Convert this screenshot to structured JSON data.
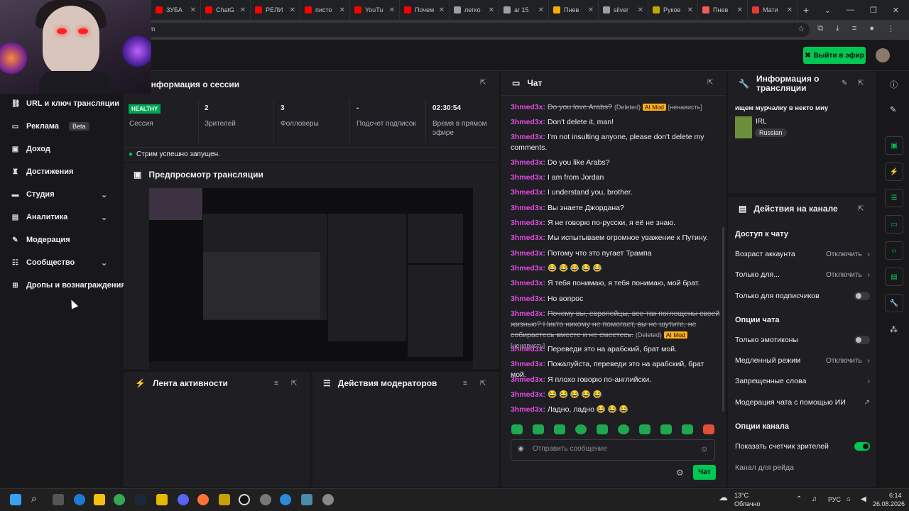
{
  "browser": {
    "tabs": [
      {
        "title": "ЗУБА",
        "color": "#ff0000"
      },
      {
        "title": "ChatG",
        "color": "#ff0000"
      },
      {
        "title": "РЕЛИ",
        "color": "#ff0000"
      },
      {
        "title": "писто",
        "color": "#ff0000"
      },
      {
        "title": "YouTu",
        "color": "#ff0000"
      },
      {
        "title": "Почем",
        "color": "#ff0000"
      },
      {
        "title": "легко",
        "color": "#9aa0a6"
      },
      {
        "title": "ar 15",
        "color": "#9aa0a6"
      },
      {
        "title": "Пнев",
        "color": "#f9ab00"
      },
      {
        "title": "silver",
        "color": "#9aa0a6"
      },
      {
        "title": "Руков",
        "color": "#c6a700"
      },
      {
        "title": "Пнев",
        "color": "#f25c54"
      },
      {
        "title": "Мати",
        "color": "#e53935"
      }
    ],
    "new_tab": "+",
    "url_fragment": "m"
  },
  "header": {
    "go_live": "Выйти в эфир"
  },
  "sidebar": {
    "items": [
      {
        "label": "URL и ключ трансляции",
        "icon": "link-icon",
        "glyph": "⛓",
        "chev": ""
      },
      {
        "label": "Реклама",
        "icon": "ads-icon",
        "glyph": "▭",
        "badge": "Beta",
        "chev": ""
      },
      {
        "label": "Доход",
        "icon": "revenue-icon",
        "glyph": "▣",
        "chev": ""
      },
      {
        "label": "Достижения",
        "icon": "trophy-icon",
        "glyph": "♜",
        "chev": ""
      },
      {
        "label": "Студия",
        "icon": "studio-icon",
        "glyph": "▬",
        "chev": "⌄"
      },
      {
        "label": "Аналитика",
        "icon": "analytics-icon",
        "glyph": "▤",
        "chev": "⌄"
      },
      {
        "label": "Модерация",
        "icon": "moderation-icon",
        "glyph": "✎",
        "chev": ""
      },
      {
        "label": "Сообщество",
        "icon": "community-icon",
        "glyph": "☷",
        "chev": "⌄"
      },
      {
        "label": "Дропы и вознаграждения",
        "icon": "drops-icon",
        "glyph": "⊞",
        "chev": ""
      }
    ]
  },
  "session": {
    "title": "Информация о сессии",
    "healthy": "HEALTHY",
    "stats": [
      {
        "value": "",
        "label": "Сессия"
      },
      {
        "value": "2",
        "label": "Зрителей"
      },
      {
        "value": "3",
        "label": "Фолловеры"
      },
      {
        "value": "-",
        "label": "Подсчет подписок"
      },
      {
        "value": "02:30:54",
        "label": "Время в прямом эфире"
      }
    ],
    "status": "Стрим успешно запущен."
  },
  "preview": {
    "title": "Предпросмотр трансляции"
  },
  "activity": {
    "title": "Лента активности"
  },
  "modactions": {
    "title": "Действия модераторов"
  },
  "chat": {
    "title": "Чат",
    "messages": [
      {
        "user": "3hmed3x:",
        "text": "Do you love Arabs?",
        "deleted": true,
        "suffix": "(Deleted)",
        "badge": "AI Mod",
        "tag": "[ненависть]"
      },
      {
        "user": "3hmed3x:",
        "text": "Don't delete it, man!"
      },
      {
        "user": "3hmed3x:",
        "text": "I'm not insulting anyone, please don't delete my comments."
      },
      {
        "user": "3hmed3x:",
        "text": "Do you like Arabs?"
      },
      {
        "user": "3hmed3x:",
        "text": "I am from Jordan"
      },
      {
        "user": "3hmed3x:",
        "text": "I understand you, brother."
      },
      {
        "user": "3hmed3x:",
        "text": "Вы знаете Джордана?"
      },
      {
        "user": "3hmed3x:",
        "text": "Я не говорю по-русски, я её не знаю."
      },
      {
        "user": "3hmed3x:",
        "text": "Мы испытываем огромное уважение к Путину."
      },
      {
        "user": "3hmed3x:",
        "text": "Потому что это пугает Трампа"
      },
      {
        "user": "3hmed3x:",
        "text": "😂 😂 😂 😂 😂"
      },
      {
        "user": "3hmed3x:",
        "text": "Я тебя понимаю, я тебя понимаю, мой брат."
      },
      {
        "user": "3hmed3x:",
        "text": "Но вопрос"
      },
      {
        "user": "3hmed3x:",
        "text": "Почему вы, европейцы, все так поглощены своей жизнью? Никто никому не помогает, вы не шутите, не собираетесь вместе и не смеетесь.",
        "deleted": true,
        "suffix": "(Deleted)",
        "badge": "AI Mod",
        "tag": "[ненависть]"
      },
      {
        "user": "3hmed3x:",
        "text": "Переведи это на арабский, брат мой."
      },
      {
        "user": "3hmed3x:",
        "text": "Пожалуйста, переведи это на арабский, брат мой."
      },
      {
        "user": "3hmed3x:",
        "text": "Я плохо говорю по-английски."
      },
      {
        "user": "3hmed3x:",
        "text": "😂 😂 😂 😂 😂"
      },
      {
        "user": "3hmed3x:",
        "text": "Ладно, ладно 😂 😂 😂"
      }
    ],
    "placeholder": "Отправить сообщение",
    "send": "Чат"
  },
  "streaminfo": {
    "title": "Информация о трансляции",
    "stream_title": "ищем мурчалку в некто миу",
    "category": "IRL",
    "language": "Russian"
  },
  "channel": {
    "title": "Действия на канале",
    "chat_access": "Доступ к чату",
    "account_age": "Возраст аккаунта",
    "account_age_val": "Отключить",
    "only_for": "Только для...",
    "only_for_val": "Отключить",
    "subs_only": "Только для подписчиков",
    "chat_options": "Опции чата",
    "emotes_only": "Только эмотиконы",
    "slow_mode": "Медленный режим",
    "slow_mode_val": "Отключить",
    "banned_words": "Запрещенные слова",
    "ai_mod": "Модерация чата с помощью ИИ",
    "channel_options": "Опции канала",
    "viewer_count": "Показать счетчик зрителей",
    "raid_channel": "Канал для рейда"
  },
  "taskbar": {
    "weather_temp": "13°C",
    "weather_desc": "Облачно",
    "lang": "РУС",
    "time": "6:14",
    "date": "26.08.2026"
  },
  "colors": {
    "accent": "#00c853",
    "username": "#e14be1",
    "ai_mod": "#ffaf1a"
  }
}
